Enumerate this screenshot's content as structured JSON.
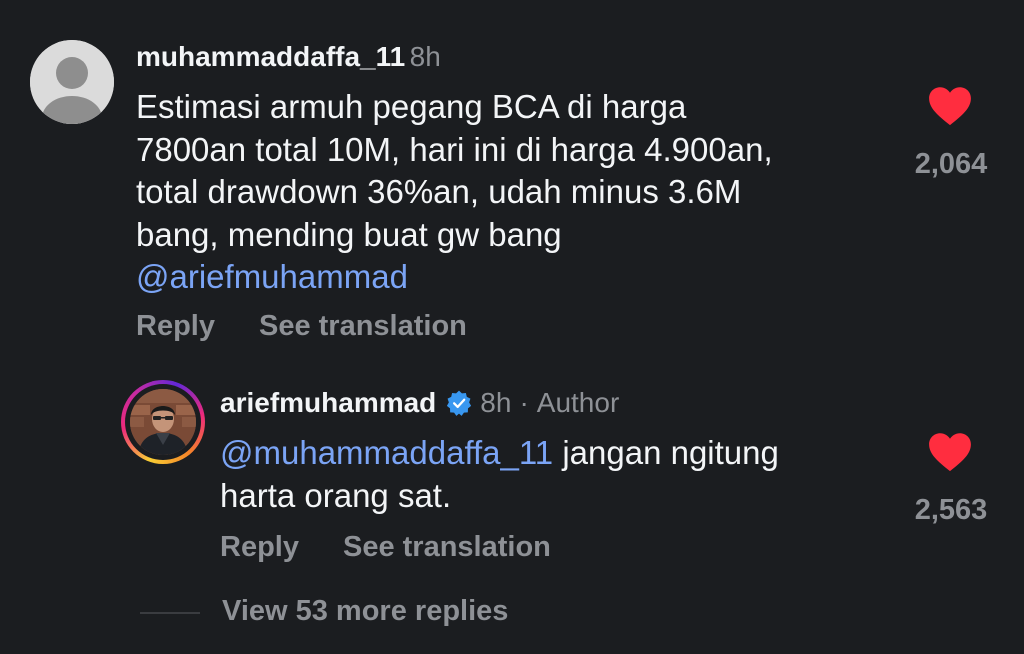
{
  "colors": {
    "background": "#1b1d20",
    "text": "#f3f5f7",
    "secondary": "#8e9196",
    "mention": "#7ba4f5",
    "heart": "#ff2d3f",
    "verified": "#3897f0"
  },
  "comment": {
    "username": "muhammaddaffa_11",
    "time": "8h",
    "text_lines": [
      "Estimasi armuh pegang BCA di harga",
      "7800an total 10M, hari ini di harga 4.900an,",
      "total drawdown 36%an, udah minus 3.6M",
      "bang, mending buat gw bang"
    ],
    "mention": "@ariefmuhammad",
    "like_count": "2,064",
    "like_icon": "heart-filled-icon",
    "reply_label": "Reply",
    "translate_label": "See translation"
  },
  "reply": {
    "username": "ariefmuhammad",
    "verified_icon": "verified-badge-icon",
    "time": "8h",
    "separator": "·",
    "author_label": "Author",
    "mention": "@muhammaddaffa_11",
    "text_first": " jangan ngitung",
    "text_second": "harta orang sat.",
    "like_count": "2,563",
    "like_icon": "heart-filled-icon",
    "reply_label": "Reply",
    "translate_label": "See translation"
  },
  "view_more_label": "View 53 more replies"
}
